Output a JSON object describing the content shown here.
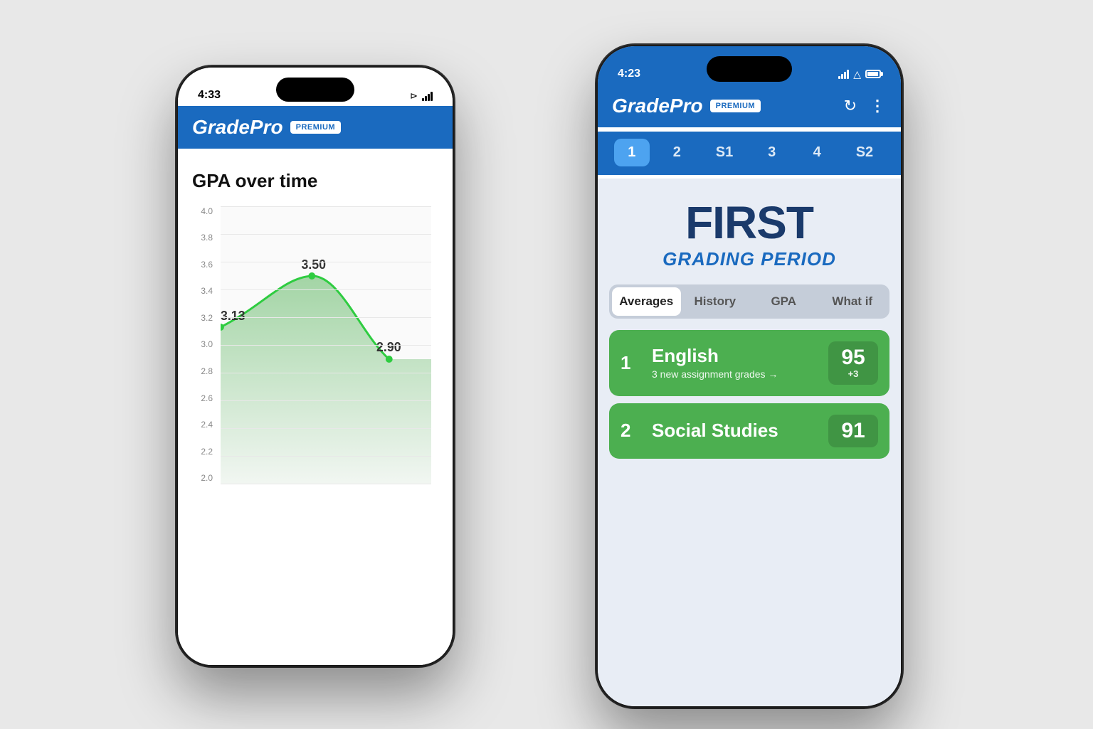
{
  "background_color": "#e0e0e0",
  "back_phone": {
    "time": "4:33",
    "logo": "GradePro",
    "premium_badge": "PREMIUM",
    "chart_title": "GPA over time",
    "y_axis_labels": [
      "4.0",
      "3.8",
      "3.6",
      "3.4",
      "3.2",
      "3.0",
      "2.8",
      "2.6",
      "2.4",
      "2.2",
      "2.0"
    ],
    "data_points": [
      {
        "label": "3.13",
        "x": 15,
        "y": 62
      },
      {
        "label": "3.50",
        "x": 45,
        "y": 30
      },
      {
        "label": "2.90",
        "x": 80,
        "y": 71
      }
    ]
  },
  "front_phone": {
    "time": "4:23",
    "status_signal": "●●●●",
    "logo": "GradePro",
    "premium_badge": "PREMIUM",
    "period_tabs": [
      {
        "label": "1",
        "active": true
      },
      {
        "label": "2",
        "active": false
      },
      {
        "label": "S1",
        "active": false
      },
      {
        "label": "3",
        "active": false
      },
      {
        "label": "4",
        "active": false
      },
      {
        "label": "S2",
        "active": false
      }
    ],
    "period_title": "FIRST",
    "period_subtitle": "GRADING PERIOD",
    "sub_tabs": [
      {
        "label": "Averages",
        "active": true
      },
      {
        "label": "History",
        "active": false
      },
      {
        "label": "GPA",
        "active": false
      },
      {
        "label": "What if",
        "active": false
      }
    ],
    "courses": [
      {
        "number": "1",
        "name": "English",
        "subtitle": "3 new assignment grades →",
        "grade": "95",
        "delta": "+3"
      },
      {
        "number": "2",
        "name": "Social Studies",
        "subtitle": "",
        "grade": "91",
        "delta": ""
      }
    ]
  }
}
